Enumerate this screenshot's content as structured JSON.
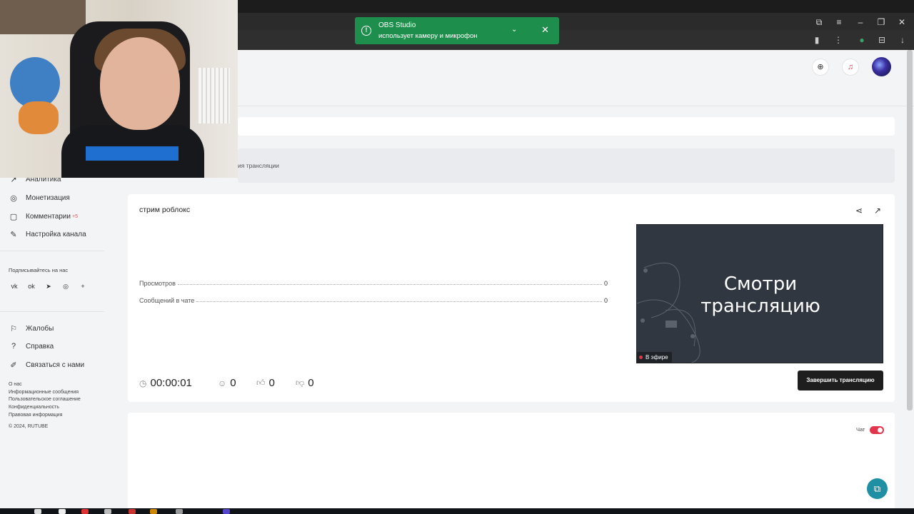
{
  "notification": {
    "title": "OBS Studio",
    "message": "использует камеру и микрофон"
  },
  "breadcrumb": "ия трансляции",
  "sidebar": {
    "items": [
      {
        "label": "Аналитика",
        "icon": "chart-icon"
      },
      {
        "label": "Монетизация",
        "icon": "coin-icon"
      },
      {
        "label": "Комментарии",
        "icon": "comment-icon",
        "badge": "+5"
      },
      {
        "label": "Настройка канала",
        "icon": "settings-icon"
      }
    ],
    "follow_label": "Подписывайтесь на нас",
    "social": [
      {
        "glyph": "vk",
        "icon": "vk-icon"
      },
      {
        "glyph": "ok",
        "icon": "odnoklassniki-icon"
      },
      {
        "glyph": "➤",
        "icon": "telegram-icon"
      },
      {
        "glyph": "◎",
        "icon": "dzen-icon"
      },
      {
        "glyph": "+",
        "icon": "plus-icon"
      }
    ],
    "help_items": [
      {
        "label": "Жалобы",
        "icon": "flag-icon"
      },
      {
        "label": "Справка",
        "icon": "question-icon"
      },
      {
        "label": "Связаться с нами",
        "icon": "pen-icon"
      }
    ],
    "footer_links": [
      "О нас",
      "Информационные сообщения",
      "Пользовательское соглашение",
      "Конфиденциальность",
      "Правовая информация"
    ],
    "copyright": "© 2024, RUTUBE"
  },
  "stream": {
    "title": "стрим роблокс",
    "stats": [
      {
        "label": "Просмотров",
        "value": "0"
      },
      {
        "label": "Сообщений в чате",
        "value": "0"
      }
    ],
    "preview_text": "Смотри трансляцию",
    "live_label": "В эфире",
    "duration": "00:00:01",
    "viewers": "0",
    "likes": "0",
    "dislikes": "0",
    "end_button": "Завершить трансляцию"
  },
  "chat": {
    "label": "Чат",
    "enabled": true
  },
  "colors": {
    "accent_green": "#1e8e4c",
    "live_red": "#e2344a",
    "help_teal": "#1f8fa3"
  }
}
